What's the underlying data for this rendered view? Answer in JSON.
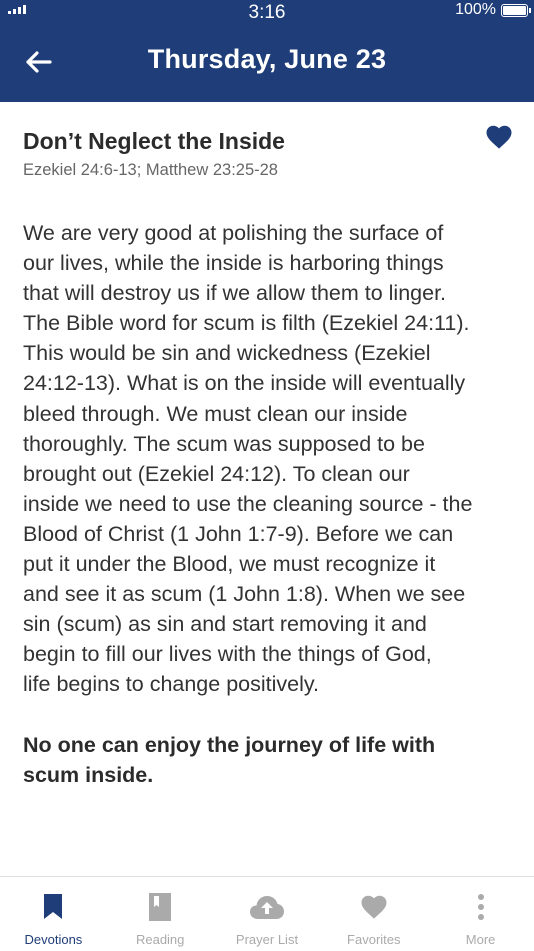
{
  "status": {
    "time": "3:16",
    "battery": "100%"
  },
  "header": {
    "title": "Thursday,  June 23"
  },
  "devotion": {
    "title": "Don’t Neglect the Inside",
    "scripture": "Ezekiel 24:6-13; Matthew 23:25-28",
    "body_lines": [
      "We are very good at polishing the surface of",
      "our lives, while the inside is harboring things",
      "that will destroy us if we allow them to linger.",
      "The Bible word for scum is filth (Ezekiel 24:11).",
      "This would be sin and wickedness (Ezekiel",
      "24:12-13).  What is on the inside will eventually",
      "bleed through.  We must clean our inside",
      "thoroughly.  The scum was supposed to be",
      "brought out (Ezekiel 24:12).   To clean our",
      "inside we need to use the cleaning source - the",
      "Blood of Christ (1 John 1:7-9).  Before we can",
      "put it under the Blood, we must recognize it",
      "and see it as scum (1 John 1:8).  When we see",
      "sin (scum) as sin and start removing it and",
      "begin to fill our lives with the things of God,",
      "life begins to change positively."
    ],
    "closing_lines": [
      "No one can enjoy the journey of life with",
      "scum inside."
    ]
  },
  "tabs": [
    {
      "label": "Devotions",
      "icon": "bookmark-icon",
      "active": true
    },
    {
      "label": "Reading",
      "icon": "book-icon",
      "active": false
    },
    {
      "label": "Prayer List",
      "icon": "cloud-upload-icon",
      "active": false
    },
    {
      "label": "Favorites",
      "icon": "heart-icon",
      "active": false
    },
    {
      "label": "More",
      "icon": "more-vertical-icon",
      "active": false
    }
  ],
  "colors": {
    "primary": "#1f3d78",
    "inactive": "#aaaaaa",
    "text": "#333333"
  }
}
